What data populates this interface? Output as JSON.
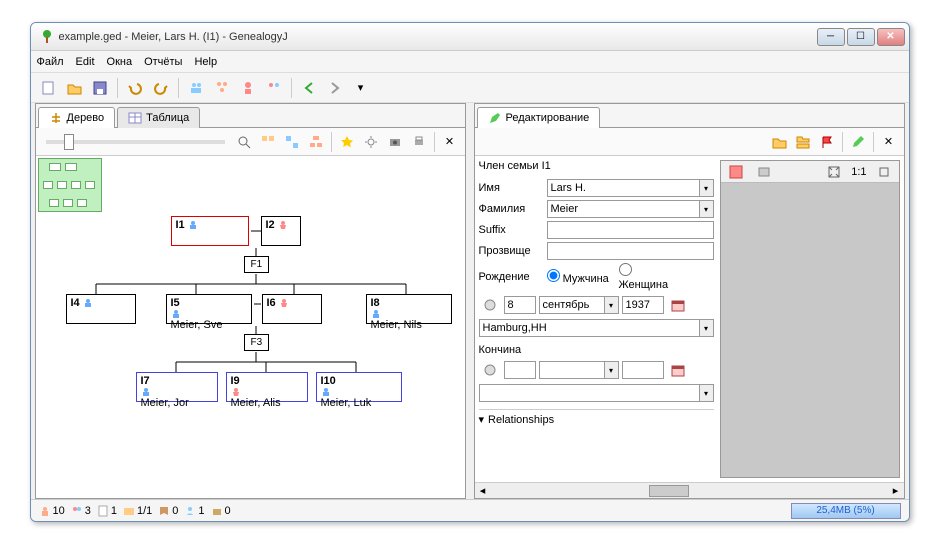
{
  "title": "example.ged - Meier, Lars H. (I1) - GenealogyJ",
  "menu": {
    "file": "Файл",
    "edit": "Edit",
    "windows": "Окна",
    "reports": "Отчёты",
    "help": "Help"
  },
  "tabs": {
    "tree": "Дерево",
    "table": "Таблица",
    "editor": "Редактирование"
  },
  "editor_toolbar": {},
  "tree": {
    "nodes": {
      "i1": "I1",
      "i2": "I2",
      "i4": "I4",
      "i5": "I5",
      "i6": "I6",
      "i8": "I8",
      "i7": "I7",
      "i9": "I9",
      "i10": "I10",
      "i5_name": "Meier, Sve",
      "i8_name": "Meier, Nils",
      "i7_name": "Meier, Jor",
      "i9_name": "Meier, Alis",
      "i10_name": "Meier, Luk",
      "f1": "F1",
      "f3": "F3"
    }
  },
  "editor": {
    "header": "Член семьи I1",
    "labels": {
      "name": "Имя",
      "surname": "Фамилия",
      "suffix": "Suffix",
      "nickname": "Прозвище",
      "birth": "Рождение",
      "death": "Кончина"
    },
    "name": "Lars H.",
    "surname": "Meier",
    "suffix": "",
    "nickname": "",
    "gender_male": "Мужчина",
    "gender_female": "Женщина",
    "birth_day": "8",
    "birth_month": "сентябрь",
    "birth_year": "1937",
    "birth_place": "Hamburg,HH",
    "death_day": "",
    "death_month": "",
    "death_year": "",
    "death_place": "",
    "relationships": "Relationships"
  },
  "media": {
    "zoom": "1:1"
  },
  "status": {
    "indi": "10",
    "fam": "3",
    "note": "1",
    "media": "1/1",
    "source": "0",
    "sub": "1",
    "repo": "0",
    "memory": "25,4MB (5%)"
  }
}
